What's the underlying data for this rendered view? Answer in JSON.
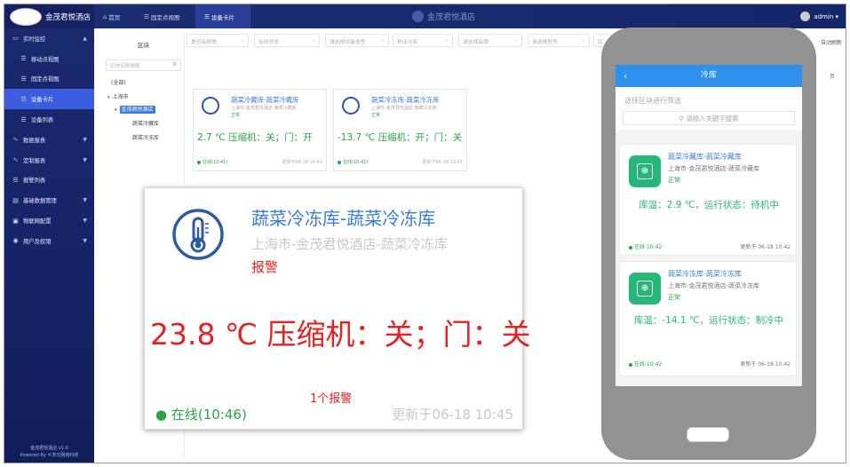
{
  "sidebar": {
    "logo_text": "金茂君悦酒店",
    "items": [
      {
        "label": "实时监控",
        "icon": "monitor-icon",
        "arrow": "▲"
      },
      {
        "label": "移动点视图",
        "icon": "list-icon",
        "sub": true
      },
      {
        "label": "固定点视图",
        "icon": "list-icon",
        "sub": true
      },
      {
        "label": "设备卡片",
        "icon": "list-icon",
        "sub": true,
        "active": true
      },
      {
        "label": "设备列表",
        "icon": "list-icon",
        "sub": true
      },
      {
        "label": "数据报表",
        "icon": "chart-icon",
        "arrow": "▼"
      },
      {
        "label": "定制报表",
        "icon": "chart-icon",
        "arrow": "▼"
      },
      {
        "label": "报警列表",
        "icon": "list-icon"
      },
      {
        "label": "基础数据管理",
        "icon": "database-icon",
        "arrow": "▼"
      },
      {
        "label": "物联网配置",
        "icon": "briefcase-icon",
        "arrow": "▼"
      },
      {
        "label": "用户及权限",
        "icon": "user-icon",
        "arrow": "▼"
      }
    ],
    "footer_line1": "金茂君悦酒店 v1.0",
    "footer_line2": "Powered By ©未冗网络科技"
  },
  "topbar": {
    "tabs": [
      {
        "label": "首页",
        "icon": "home-icon"
      },
      {
        "label": "固定点视图",
        "icon": "list-icon"
      },
      {
        "label": "设备卡片",
        "icon": "list-icon",
        "active": true
      }
    ],
    "center_brand": "金茂君悦酒店",
    "user": "admin ▾"
  },
  "filters": [
    {
      "label": "是否有报警"
    },
    {
      "label": "在线状态"
    },
    {
      "label": "请选择设备类型"
    },
    {
      "label": "移动冷库"
    },
    {
      "label": "请选择品牌"
    },
    {
      "label": "请选择型号"
    },
    {
      "label": "区"
    }
  ],
  "auto_refresh": "自动刷新",
  "tree": {
    "title": "区块",
    "search_placeholder": "区块名称搜索",
    "nodes": [
      "(全部)",
      "上海市",
      "金茂君悦酒店",
      "蔬菜冷藏库",
      "蔬菜冷冻库"
    ]
  },
  "cards": [
    {
      "title": "蔬菜冷藏库-蔬菜冷藏库",
      "location": "上海市-金茂君悦酒店-蔬菜冷藏库",
      "status": "正常",
      "reading": "2.7 ℃ 压缩机：关；门：开",
      "online": "在线(10:41)",
      "updated": "更新于06-18 10:41"
    },
    {
      "title": "蔬菜冷冻库-蔬菜冷冻库",
      "location": "上海市-金茂君悦酒店-蔬菜冷冻库",
      "status": "正常",
      "reading": "-13.7 ℃ 压缩机：开；门：关",
      "online": "在线(10:41)",
      "updated": "更新于06-18 10:41"
    }
  ],
  "zoom": {
    "title": "蔬菜冷冻库-蔬菜冷冻库",
    "location": "上海市-金茂君悦酒店-蔬菜冷冻库",
    "status": "报警",
    "reading": "23.8 ℃ 压缩机：关；门：关",
    "alarm_count": "1个报警",
    "online": "在线(10:46)",
    "updated": "更新于06-18 10:45"
  },
  "phone": {
    "title": "冷库",
    "back": "‹",
    "filter_placeholder": "选择区块进行筛选",
    "search_placeholder": "请输入关键字搜索",
    "cards": [
      {
        "name": "蔬菜冷藏库-蔬菜冷藏库",
        "location": "上海市-金茂君悦酒店-蔬菜冷藏库",
        "status": "正常",
        "summary": "库温：2.9 ℃，运行状态：待机中",
        "online": "在线 10:42",
        "updated": "更新于 06-18 10:42"
      },
      {
        "name": "蔬菜冷冻库-蔬菜冷冻库",
        "location": "上海市-金茂君悦酒店-蔬菜冷冻库",
        "status": "正常",
        "summary": "库温：-14.1 ℃，运行状态：制冷中",
        "online": "在线 10:42",
        "updated": "更新于 06-18 10:42"
      }
    ]
  },
  "right_tag": "页"
}
